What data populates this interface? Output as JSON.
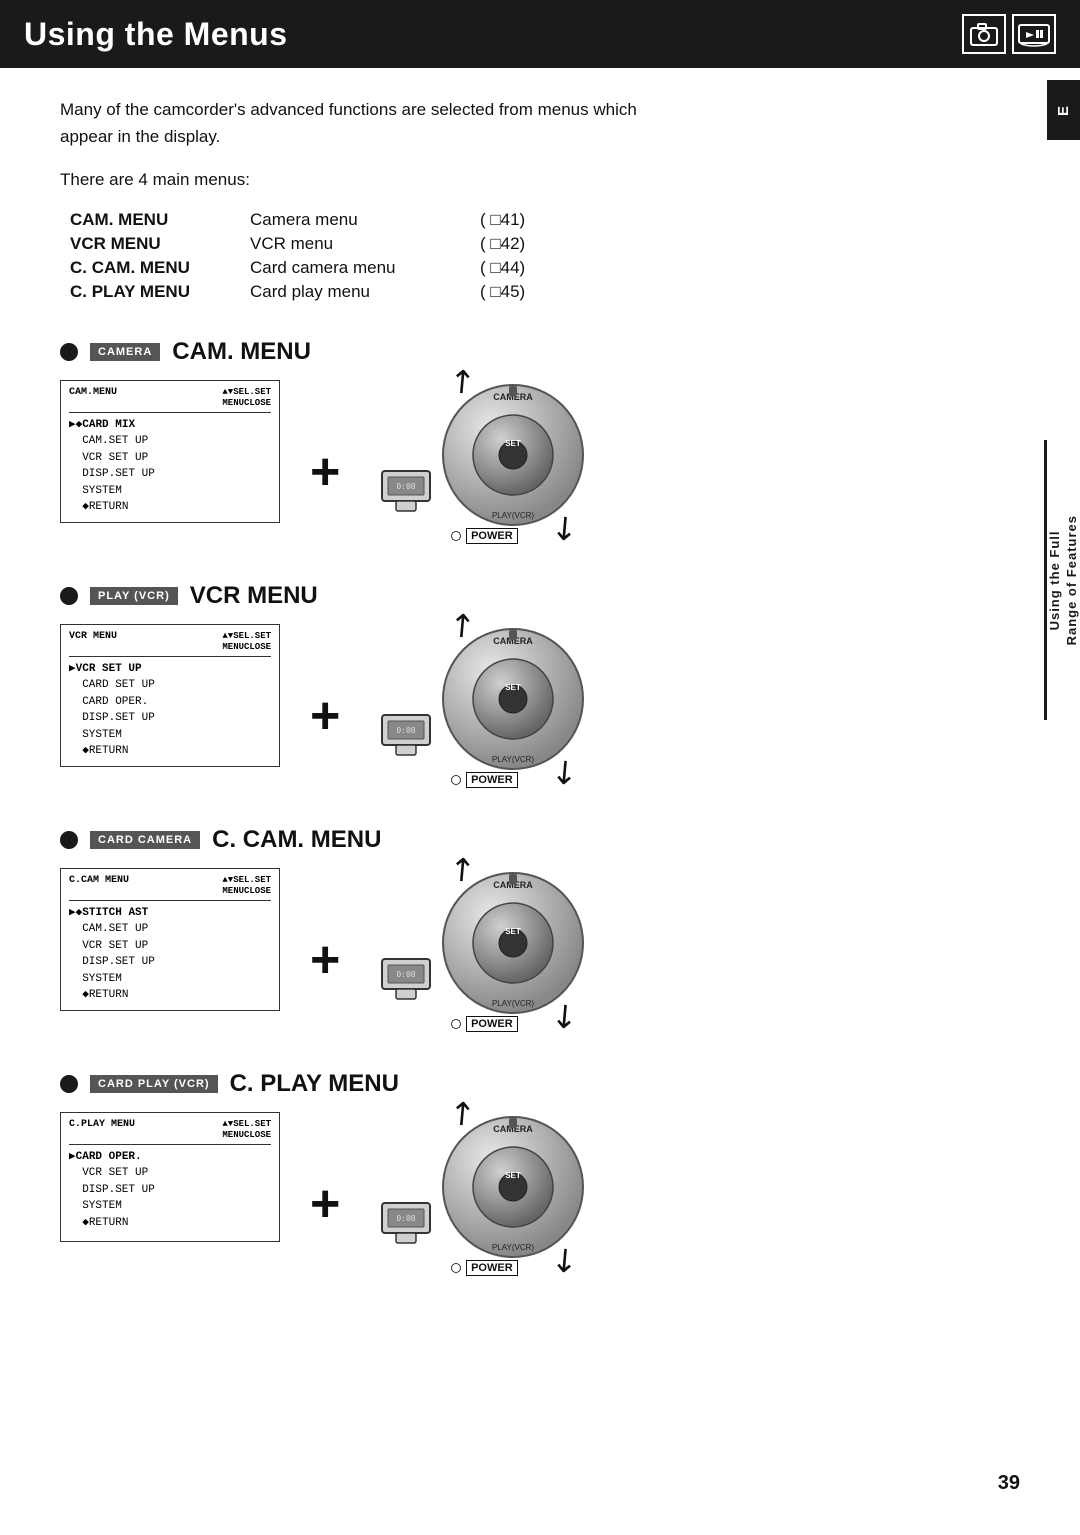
{
  "page": {
    "title": "Using the Menus",
    "page_number": "39",
    "tab_label": "E"
  },
  "header": {
    "icons": [
      "📷",
      "📷"
    ]
  },
  "intro": {
    "line1": "Many of the camcorder's advanced functions are selected from menus which",
    "line2": "appear in the display.",
    "sub": "There are 4 main menus:"
  },
  "menu_list": [
    {
      "id": "CAM. MENU",
      "desc": "Camera menu",
      "ref": "( \u000141)"
    },
    {
      "id": "VCR MENU",
      "desc": "VCR menu",
      "ref": "( \u000142)"
    },
    {
      "id": "C. CAM. MENU",
      "desc": "Card camera menu",
      "ref": "( \u000144)"
    },
    {
      "id": "C. PLAY MENU",
      "desc": "Card play menu",
      "ref": "( \u000145)"
    }
  ],
  "sections": [
    {
      "id": "cam-menu",
      "badge": "CAMERA",
      "title": "CAM. MENU",
      "screen_title": "CAM.MENU",
      "screen_header_right": "▲▼SEL.SETSET\nMENUCLOSE",
      "items": [
        {
          "text": "▶◆CARD MIX",
          "active": true
        },
        {
          "text": "CAM.SET UP",
          "active": false
        },
        {
          "text": "VCR SET UP",
          "active": false
        },
        {
          "text": "DISP.SET UP",
          "active": false
        },
        {
          "text": "SYSTEM",
          "active": false
        },
        {
          "text": "◆RETURN",
          "active": false
        }
      ],
      "dial_top": "CAMERA",
      "dial_right": "",
      "dial_bottom": "PLAY(VCR)"
    },
    {
      "id": "vcr-menu",
      "badge": "PLAY (VCR)",
      "title": "VCR MENU",
      "screen_title": "VCR MENU",
      "screen_header_right": "▲▼SEL.SETSET\nMENUCLOSE",
      "items": [
        {
          "text": "▶VCR SET UP",
          "active": true
        },
        {
          "text": "CARD SET UP",
          "active": false
        },
        {
          "text": "CARD OPER.",
          "active": false
        },
        {
          "text": "DISP.SET UP",
          "active": false
        },
        {
          "text": "SYSTEM",
          "active": false
        },
        {
          "text": "◆RETURN",
          "active": false
        }
      ],
      "dial_top": "CAMERA",
      "dial_bottom": "PLAY(VCR)"
    },
    {
      "id": "c-cam-menu",
      "badge": "CARD CAMERA",
      "title": "C. CAM. MENU",
      "screen_title": "C.CAM MENU",
      "screen_header_right": "▲▼SEL.SETSET\nMENUCLOSE",
      "items": [
        {
          "text": "▶◆STITCH AST",
          "active": true
        },
        {
          "text": "CAM.SET UP",
          "active": false
        },
        {
          "text": "VCR SET UP",
          "active": false
        },
        {
          "text": "DISP.SET UP",
          "active": false
        },
        {
          "text": "SYSTEM",
          "active": false
        },
        {
          "text": "◆RETURN",
          "active": false
        }
      ],
      "dial_top": "CAMERA",
      "dial_bottom": "PLAY(VCR)"
    },
    {
      "id": "c-play-menu",
      "badge": "CARD PLAY (VCR)",
      "title": "C. PLAY MENU",
      "screen_title": "C.PLAY MENU",
      "screen_header_right": "▲▼SEL.SETSET\nMENUCLOSE",
      "items": [
        {
          "text": "▶CARD OPER.",
          "active": true
        },
        {
          "text": "VCR SET UP",
          "active": false
        },
        {
          "text": "DISP.SET UP",
          "active": false
        },
        {
          "text": "SYSTEM",
          "active": false
        },
        {
          "text": "◆RETURN",
          "active": false
        }
      ],
      "dial_top": "CAMERA",
      "dial_bottom": "PLAY(VCR)"
    }
  ],
  "right_sidebar": {
    "line1": "Using the Full",
    "line2": "Range of Features"
  },
  "plus_sign": "+"
}
